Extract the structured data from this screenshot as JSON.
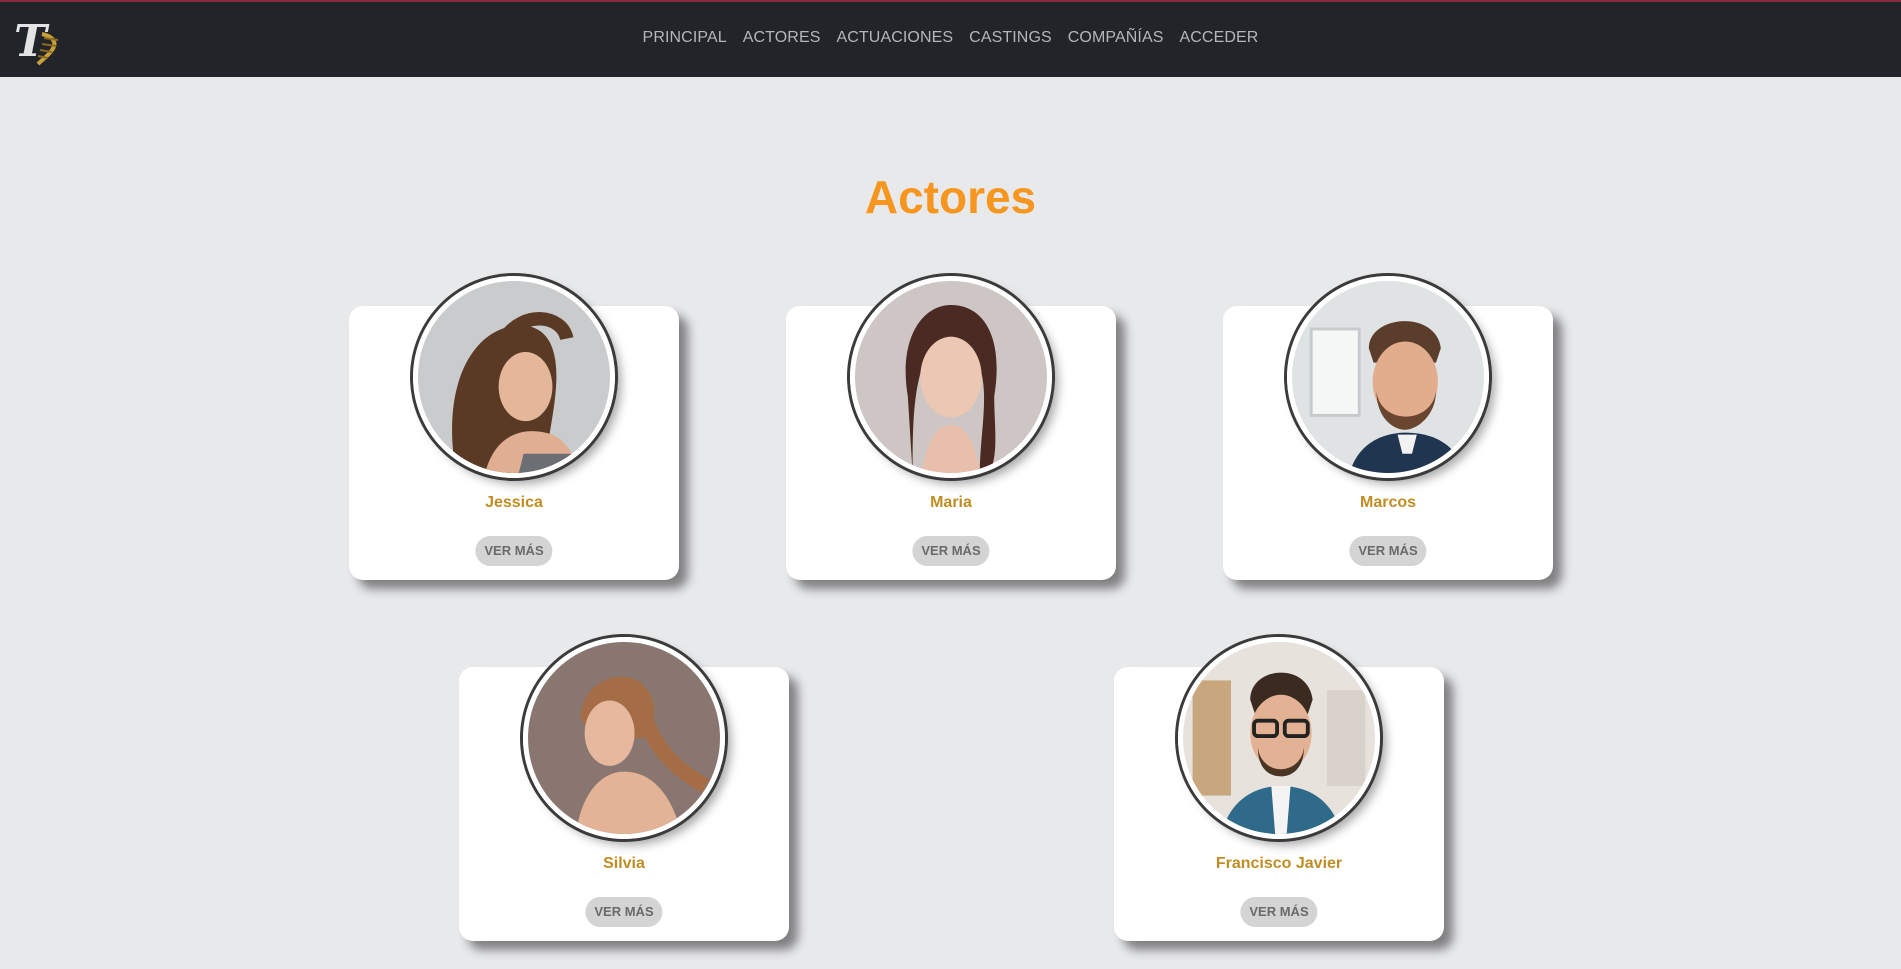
{
  "nav": {
    "logo_letter": "T",
    "items": [
      {
        "label": "PRINCIPAL"
      },
      {
        "label": "ACTORES"
      },
      {
        "label": "ACTUACIONES"
      },
      {
        "label": "CASTINGS"
      },
      {
        "label": "COMPAÑÍAS"
      },
      {
        "label": "ACCEDER"
      }
    ]
  },
  "page": {
    "title": "Actores"
  },
  "actors": [
    {
      "name": "Jessica",
      "button": "VER MÁS"
    },
    {
      "name": "Maria",
      "button": "VER MÁS"
    },
    {
      "name": "Marcos",
      "button": "VER MÁS"
    },
    {
      "name": "Silvia",
      "button": "VER MÁS"
    },
    {
      "name": "Francisco Javier",
      "button": "VER MÁS"
    }
  ],
  "colors": {
    "navbar": "#212529",
    "title": "#f7961e",
    "actor_name": "#c08d24",
    "button_bg": "#d4d4d4",
    "page_bg": "#e8e9eb"
  }
}
